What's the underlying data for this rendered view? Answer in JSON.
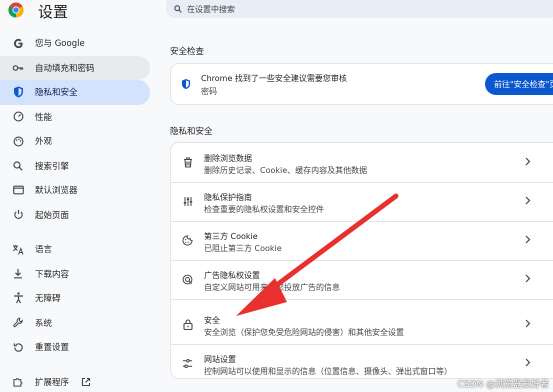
{
  "header": {
    "app_title": "设置",
    "search_placeholder": "在设置中搜索"
  },
  "sidebar": {
    "items": [
      {
        "label": "您与 Google",
        "icon": "google-icon"
      },
      {
        "label": "自动填充和密码",
        "icon": "key-icon"
      },
      {
        "label": "隐私和安全",
        "icon": "shield-icon"
      },
      {
        "label": "性能",
        "icon": "speedometer-icon"
      },
      {
        "label": "外观",
        "icon": "palette-icon"
      },
      {
        "label": "搜索引擎",
        "icon": "search-icon"
      },
      {
        "label": "默认浏览器",
        "icon": "browser-window-icon"
      },
      {
        "label": "起始页面",
        "icon": "power-icon"
      },
      {
        "label": "语言",
        "icon": "translate-icon"
      },
      {
        "label": "下载内容",
        "icon": "download-icon"
      },
      {
        "label": "无障碍",
        "icon": "accessibility-icon"
      },
      {
        "label": "系统",
        "icon": "wrench-icon"
      },
      {
        "label": "重置设置",
        "icon": "history-icon"
      },
      {
        "label": "扩展程序",
        "icon": "puzzle-icon"
      }
    ],
    "active_item": "隐私和安全"
  },
  "safety_check": {
    "section_label": "安全检查",
    "title": "Chrome 找到了一些安全建议需要您审核",
    "subtitle": "密码",
    "button_label": "前往\"安全检查\"页"
  },
  "privacy": {
    "section_label": "隐私和安全",
    "rows": [
      {
        "title": "删除浏览数据",
        "subtitle": "删除历史记录、Cookie、缓存内容及其他数据",
        "icon": "trash-icon"
      },
      {
        "title": "隐私保护指南",
        "subtitle": "检查重要的隐私权设置和安全控件",
        "icon": "sliders-icon"
      },
      {
        "title": "第三方 Cookie",
        "subtitle": "已阻止第三方 Cookie",
        "icon": "cookie-icon"
      },
      {
        "title": "广告隐私权设置",
        "subtitle": "自定义网站可用来向您投放广告的信息",
        "icon": "ad-privacy-icon"
      },
      {
        "title": "安全",
        "subtitle": "安全浏览（保护您免受危险网站的侵害）和其他安全设置",
        "icon": "lock-icon"
      },
      {
        "title": "网站设置",
        "subtitle": "控制网站可以使用和显示的信息（位置信息、摄像头、弹出式窗口等）",
        "icon": "site-settings-icon"
      }
    ]
  },
  "colors": {
    "accent": "#0b57d0",
    "active_bg": "#d3e3fd",
    "annotation_arrow": "#e8312f"
  },
  "watermark": "CSDN @浏览器爱好者"
}
